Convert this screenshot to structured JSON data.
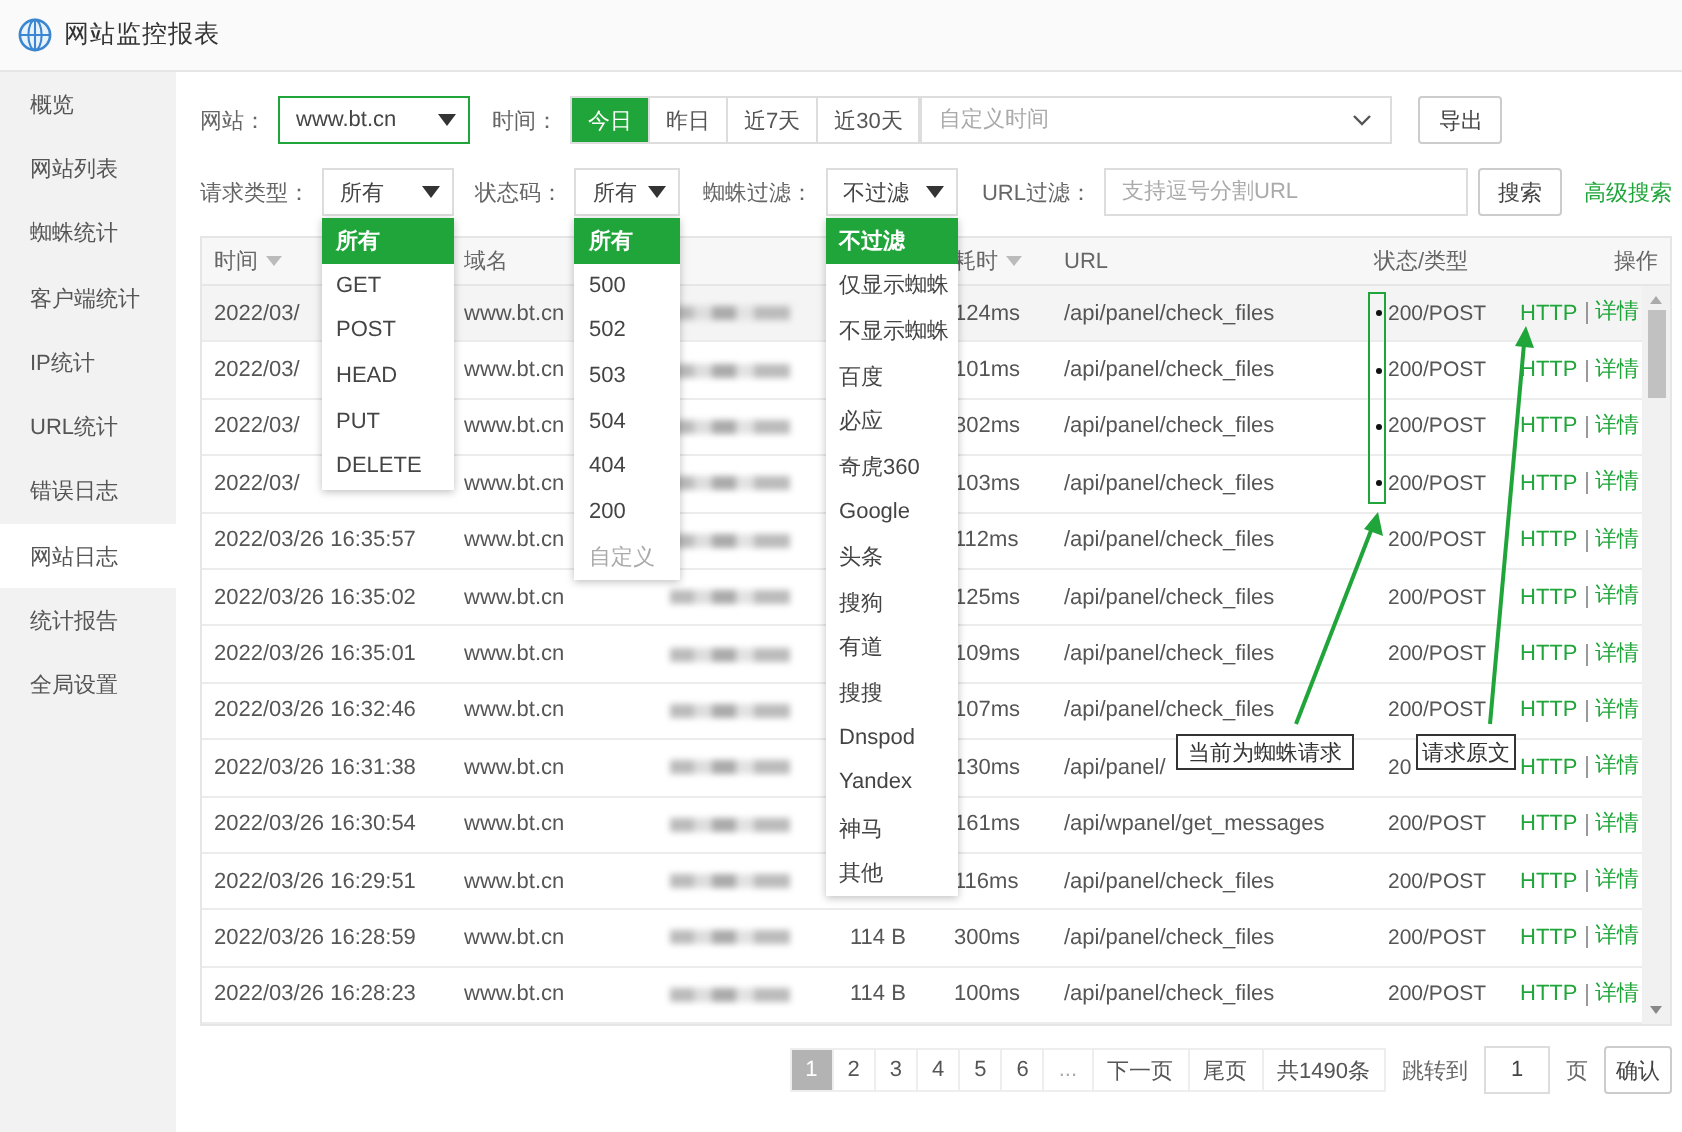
{
  "window": {
    "title": "网站监控报表"
  },
  "sidebar": {
    "items": [
      {
        "label": "概览",
        "selected": false
      },
      {
        "label": "网站列表",
        "selected": false
      },
      {
        "label": "蜘蛛统计",
        "selected": false
      },
      {
        "label": "客户端统计",
        "selected": false
      },
      {
        "label": "IP统计",
        "selected": false
      },
      {
        "label": "URL统计",
        "selected": false
      },
      {
        "label": "错误日志",
        "selected": false
      },
      {
        "label": "网站日志",
        "selected": true
      },
      {
        "label": "统计报告",
        "selected": false
      },
      {
        "label": "全局设置",
        "selected": false
      }
    ]
  },
  "toolbar": {
    "site_label": "网站：",
    "site_value": "www.bt.cn",
    "time_label": "时间：",
    "time_tabs": [
      {
        "label": "今日",
        "selected": true
      },
      {
        "label": "昨日",
        "selected": false
      },
      {
        "label": "近7天",
        "selected": false
      },
      {
        "label": "近30天",
        "selected": false
      }
    ],
    "custom_time_placeholder": "自定义时间",
    "export_button": "导出"
  },
  "filters": {
    "request_type": {
      "label": "请求类型：",
      "value": "所有",
      "options": [
        {
          "label": "所有",
          "selected": true,
          "disabled": false
        },
        {
          "label": "GET",
          "selected": false,
          "disabled": false
        },
        {
          "label": "POST",
          "selected": false,
          "disabled": false
        },
        {
          "label": "HEAD",
          "selected": false,
          "disabled": false
        },
        {
          "label": "PUT",
          "selected": false,
          "disabled": false
        },
        {
          "label": "DELETE",
          "selected": false,
          "disabled": false
        }
      ]
    },
    "status_code": {
      "label": "状态码：",
      "value": "所有",
      "options": [
        {
          "label": "所有",
          "selected": true,
          "disabled": false
        },
        {
          "label": "500",
          "selected": false,
          "disabled": false
        },
        {
          "label": "502",
          "selected": false,
          "disabled": false
        },
        {
          "label": "503",
          "selected": false,
          "disabled": false
        },
        {
          "label": "504",
          "selected": false,
          "disabled": false
        },
        {
          "label": "404",
          "selected": false,
          "disabled": false
        },
        {
          "label": "200",
          "selected": false,
          "disabled": false
        },
        {
          "label": "自定义",
          "selected": false,
          "disabled": true
        }
      ]
    },
    "spider_filter": {
      "label": "蜘蛛过滤：",
      "value": "不过滤",
      "options": [
        {
          "label": "不过滤",
          "selected": true,
          "disabled": false
        },
        {
          "label": "仅显示蜘蛛",
          "selected": false,
          "disabled": false
        },
        {
          "label": "不显示蜘蛛",
          "selected": false,
          "disabled": false
        },
        {
          "label": "百度",
          "selected": false,
          "disabled": false
        },
        {
          "label": "必应",
          "selected": false,
          "disabled": false
        },
        {
          "label": "奇虎360",
          "selected": false,
          "disabled": false
        },
        {
          "label": "Google",
          "selected": false,
          "disabled": false
        },
        {
          "label": "头条",
          "selected": false,
          "disabled": false
        },
        {
          "label": "搜狗",
          "selected": false,
          "disabled": false
        },
        {
          "label": "有道",
          "selected": false,
          "disabled": false
        },
        {
          "label": "搜搜",
          "selected": false,
          "disabled": false
        },
        {
          "label": "Dnspod",
          "selected": false,
          "disabled": false
        },
        {
          "label": "Yandex",
          "selected": false,
          "disabled": false
        },
        {
          "label": "神马",
          "selected": false,
          "disabled": false
        },
        {
          "label": "其他",
          "selected": false,
          "disabled": false
        }
      ]
    },
    "url_filter": {
      "label": "URL过滤：",
      "placeholder": "支持逗号分割URL"
    },
    "search_button": "搜索",
    "advanced_search_link": "高级搜索"
  },
  "table": {
    "columns": [
      {
        "label": "时间",
        "sortable": true
      },
      {
        "label": "域名",
        "sortable": false
      },
      {
        "label": "耗时",
        "sortable": true
      },
      {
        "label": "URL",
        "sortable": false
      },
      {
        "label": "状态/类型",
        "sortable": false
      },
      {
        "label": "操作",
        "sortable": false
      }
    ],
    "rows": [
      {
        "time": "2022/03/",
        "domain": "www.bt.cn",
        "latency": "124ms",
        "url": "/api/panel/check_files",
        "status": "200/POST",
        "spider": true,
        "actions": [
          "HTTP",
          "详情"
        ]
      },
      {
        "time": "2022/03/",
        "domain": "www.bt.cn",
        "latency": "101ms",
        "url": "/api/panel/check_files",
        "status": "200/POST",
        "spider": true,
        "actions": [
          "HTTP",
          "详情"
        ]
      },
      {
        "time": "2022/03/",
        "domain": "www.bt.cn",
        "latency": "302ms",
        "url": "/api/panel/check_files",
        "status": "200/POST",
        "spider": true,
        "actions": [
          "HTTP",
          "详情"
        ]
      },
      {
        "time": "2022/03/",
        "domain": "www.bt.cn",
        "latency": "103ms",
        "url": "/api/panel/check_files",
        "status": "200/POST",
        "spider": true,
        "actions": [
          "HTTP",
          "详情"
        ]
      },
      {
        "time": "2022/03/26 16:35:57",
        "domain": "www.bt.cn",
        "latency": "112ms",
        "url": "/api/panel/check_files",
        "status": "200/POST",
        "spider": false,
        "actions": [
          "HTTP",
          "详情"
        ]
      },
      {
        "time": "2022/03/26 16:35:02",
        "domain": "www.bt.cn",
        "latency": "125ms",
        "url": "/api/panel/check_files",
        "status": "200/POST",
        "spider": false,
        "actions": [
          "HTTP",
          "详情"
        ]
      },
      {
        "time": "2022/03/26 16:35:01",
        "domain": "www.bt.cn",
        "latency": "109ms",
        "url": "/api/panel/check_files",
        "status": "200/POST",
        "spider": false,
        "actions": [
          "HTTP",
          "详情"
        ]
      },
      {
        "time": "2022/03/26 16:32:46",
        "domain": "www.bt.cn",
        "latency": "107ms",
        "url": "/api/panel/check_files",
        "status": "200/POST",
        "spider": false,
        "actions": [
          "HTTP",
          "详情"
        ]
      },
      {
        "time": "2022/03/26 16:31:38",
        "domain": "www.bt.cn",
        "latency": "130ms",
        "url": "/api/panel/",
        "status": "20",
        "spider": false,
        "actions": [
          "HTTP",
          "详情"
        ]
      },
      {
        "time": "2022/03/26 16:30:54",
        "domain": "www.bt.cn",
        "latency": "161ms",
        "url": "/api/wpanel/get_messages",
        "status": "200/POST",
        "spider": false,
        "actions": [
          "HTTP",
          "详情"
        ]
      },
      {
        "time": "2022/03/26 16:29:51",
        "domain": "www.bt.cn",
        "latency": "116ms",
        "url": "/api/panel/check_files",
        "status": "200/POST",
        "spider": false,
        "actions": [
          "HTTP",
          "详情"
        ]
      },
      {
        "time": "2022/03/26 16:28:59",
        "domain": "www.bt.cn",
        "size": "114 B",
        "latency": "300ms",
        "url": "/api/panel/check_files",
        "status": "200/POST",
        "spider": false,
        "actions": [
          "HTTP",
          "详情"
        ]
      },
      {
        "time": "2022/03/26 16:28:23",
        "domain": "www.bt.cn",
        "size": "114 B",
        "latency": "100ms",
        "url": "/api/panel/check_files",
        "status": "200/POST",
        "spider": false,
        "actions": [
          "HTTP",
          "详情"
        ]
      }
    ]
  },
  "annotations": [
    {
      "text": "当前为蜘蛛请求"
    },
    {
      "text": "请求原文"
    }
  ],
  "pagination": {
    "pages": [
      {
        "label": "1",
        "selected": true,
        "kind": "page"
      },
      {
        "label": "2",
        "selected": false,
        "kind": "page"
      },
      {
        "label": "3",
        "selected": false,
        "kind": "page"
      },
      {
        "label": "4",
        "selected": false,
        "kind": "page"
      },
      {
        "label": "5",
        "selected": false,
        "kind": "page"
      },
      {
        "label": "6",
        "selected": false,
        "kind": "page"
      },
      {
        "label": "...",
        "selected": false,
        "kind": "ellipsis"
      }
    ],
    "next": "下一页",
    "last": "尾页",
    "total": "共1490条",
    "jump_label": "跳转到",
    "jump_value": "1",
    "page_unit": "页",
    "confirm_button": "确认"
  }
}
